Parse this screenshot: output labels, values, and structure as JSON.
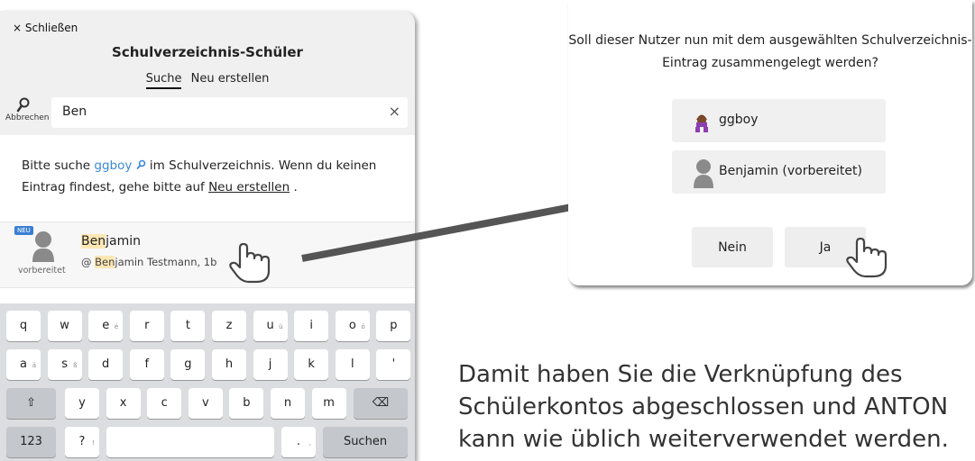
{
  "left": {
    "close_label": "× Schließen",
    "title": "Schulverzeichnis-Schüler",
    "tabs": [
      {
        "label": "Suche",
        "active": true
      },
      {
        "label": "Neu erstellen",
        "active": false
      }
    ],
    "search_button_label": "Abbrechen",
    "search_value": "Ben",
    "clear_icon": "×",
    "hint_prefix": "Bitte suche ",
    "hint_user": "ggboy",
    "hint_middle": " im Schulverzeichnis. Wenn du keinen Eintrag findest, gehe bitte auf ",
    "hint_link": "Neu erstellen",
    "hint_suffix": " .",
    "result": {
      "badge": "NEU",
      "status": "vorbereitet",
      "name_highlight": "Ben",
      "name_rest": "jamin",
      "sub_prefix": "@ ",
      "sub_highlight": "Ben",
      "sub_rest": "jamin Testmann, 1b"
    }
  },
  "keyboard": {
    "row1": [
      {
        "k": "q",
        "alt": ""
      },
      {
        "k": "w",
        "alt": ""
      },
      {
        "k": "e",
        "alt": "é"
      },
      {
        "k": "r",
        "alt": ""
      },
      {
        "k": "t",
        "alt": ""
      },
      {
        "k": "z",
        "alt": ""
      },
      {
        "k": "u",
        "alt": "ü"
      },
      {
        "k": "i",
        "alt": ""
      },
      {
        "k": "o",
        "alt": "ö"
      },
      {
        "k": "p",
        "alt": ""
      }
    ],
    "row2": [
      {
        "k": "a",
        "alt": "ä"
      },
      {
        "k": "s",
        "alt": "ß"
      },
      {
        "k": "d",
        "alt": ""
      },
      {
        "k": "f",
        "alt": ""
      },
      {
        "k": "g",
        "alt": ""
      },
      {
        "k": "h",
        "alt": ""
      },
      {
        "k": "j",
        "alt": ""
      },
      {
        "k": "k",
        "alt": ""
      },
      {
        "k": "l",
        "alt": ""
      },
      {
        "k": "'",
        "alt": ""
      }
    ],
    "row3": [
      {
        "k": "y",
        "alt": ""
      },
      {
        "k": "x",
        "alt": ""
      },
      {
        "k": "c",
        "alt": ""
      },
      {
        "k": "v",
        "alt": ""
      },
      {
        "k": "b",
        "alt": ""
      },
      {
        "k": "n",
        "alt": ""
      },
      {
        "k": "m",
        "alt": ""
      }
    ],
    "shift": "⇧",
    "backspace": "⌫",
    "numbers": "123",
    "question": "?",
    "question_alt": "!",
    "period": ".",
    "period_alt": ",",
    "submit": "Suchen"
  },
  "dialog": {
    "question": "Soll dieser Nutzer nun mit dem ausgewählten Schulverzeichnis-Eintrag zusammengelegt werden?",
    "option_user": "ggboy",
    "option_entry": "Benjamin (vorbereitet)",
    "no_label": "Nein",
    "yes_label": "Ja"
  },
  "caption": "Damit haben Sie die Verknüpfung des Schülerkontos abgeschlossen und ANTON kann wie üblich weiterverwendet werden.",
  "colors": {
    "link": "#3a8ad6",
    "highlight": "#fde7b3",
    "badge": "#3a7fd5",
    "arrow": "#555555"
  }
}
